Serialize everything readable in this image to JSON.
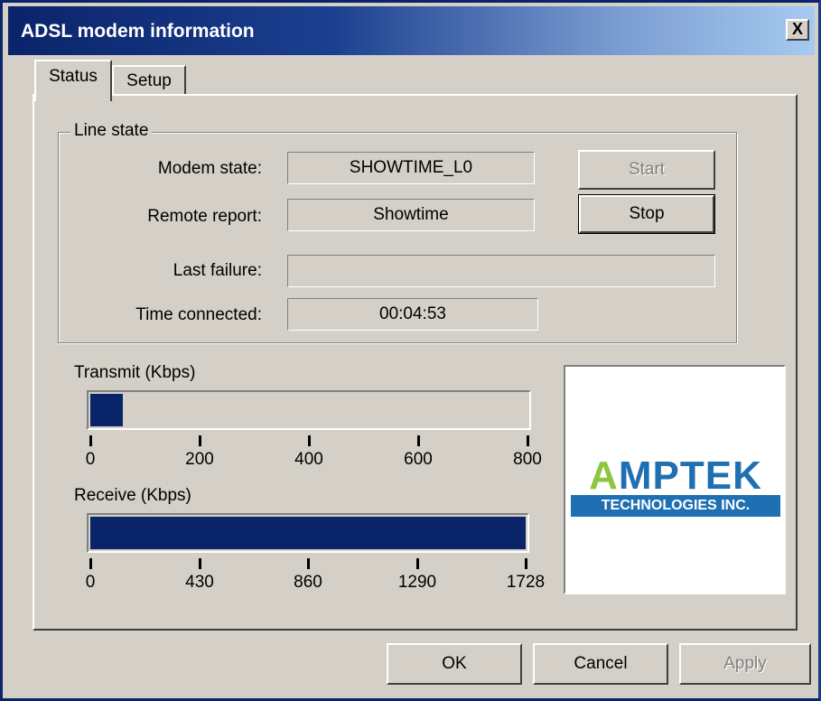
{
  "window": {
    "title": "ADSL modem information",
    "close_glyph": "X"
  },
  "tabs": [
    {
      "label": "Status",
      "active": true
    },
    {
      "label": "Setup",
      "active": false
    }
  ],
  "line_state": {
    "group_label": "Line state",
    "modem_state_label": "Modem state:",
    "modem_state_value": "SHOWTIME_L0",
    "remote_report_label": "Remote report:",
    "remote_report_value": "Showtime",
    "last_failure_label": "Last failure:",
    "last_failure_value": "",
    "time_connected_label": "Time connected:",
    "time_connected_value": "00:04:53",
    "start_label": "Start",
    "stop_label": "Stop"
  },
  "transmit": {
    "label": "Transmit (Kbps)",
    "ticks": [
      "0",
      "200",
      "400",
      "600",
      "800"
    ],
    "max": 800,
    "level": 60
  },
  "receive": {
    "label": "Receive (Kbps)",
    "ticks": [
      "0",
      "430",
      "860",
      "1290",
      "1728"
    ],
    "max": 1728,
    "level": 1728
  },
  "logo": {
    "word_a": "A",
    "word_rest": "MPTEK",
    "subtitle": "TECHNOLOGIES INC."
  },
  "buttons": {
    "ok": "OK",
    "cancel": "Cancel",
    "apply": "Apply"
  },
  "colors": {
    "title_start": "#0a246a",
    "fill": "#0a246a",
    "face": "#d4d0c8",
    "logo_blue": "#1f6fb3",
    "logo_green": "#8dc63f"
  }
}
